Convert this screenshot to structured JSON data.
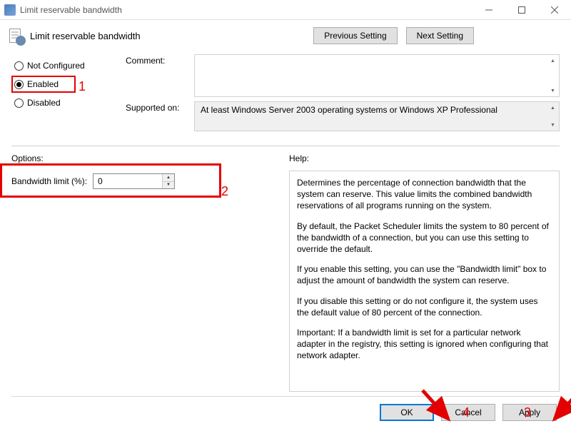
{
  "window": {
    "title": "Limit reservable bandwidth"
  },
  "header": {
    "title": "Limit reservable bandwidth"
  },
  "nav": {
    "prev": "Previous Setting",
    "next": "Next Setting"
  },
  "state": {
    "not_configured": "Not Configured",
    "enabled": "Enabled",
    "disabled": "Disabled"
  },
  "labels": {
    "comment": "Comment:",
    "supported": "Supported on:",
    "options": "Options:",
    "help": "Help:",
    "bandwidth": "Bandwidth limit (%):"
  },
  "supported_text": "At least Windows Server 2003 operating systems or Windows XP Professional",
  "options": {
    "bandwidth_value": "0"
  },
  "help": {
    "p1": "Determines the percentage of connection bandwidth that the system can reserve. This value limits the combined bandwidth reservations of all programs running on the system.",
    "p2": "By default, the Packet Scheduler limits the system to 80 percent of the bandwidth of a connection, but you can use this setting to override the default.",
    "p3": "If you enable this setting, you can use the \"Bandwidth limit\" box to adjust the amount of bandwidth the system can reserve.",
    "p4": "If you disable this setting or do not configure it, the system uses the default value of 80 percent of the connection.",
    "p5": "Important: If a bandwidth limit is set for a particular network adapter in the registry, this setting is ignored when configuring that network adapter."
  },
  "buttons": {
    "ok": "OK",
    "cancel": "Cancel",
    "apply": "Apply"
  },
  "annotations": {
    "n1": "1",
    "n2": "2",
    "n3": "3",
    "n4": "4"
  }
}
